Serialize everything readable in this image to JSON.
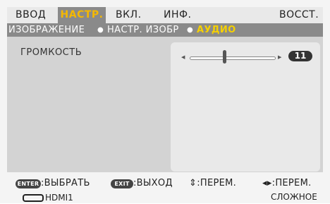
{
  "tabs": [
    {
      "label": "ВВОД",
      "active": false
    },
    {
      "label": "НАСТР.",
      "active": true
    },
    {
      "label": "ВКЛ.",
      "active": false
    },
    {
      "label": "ИНФ.",
      "active": false
    },
    {
      "label": "ВОССТ.",
      "active": false
    }
  ],
  "breadcrumb": {
    "items": [
      "ИЗОБРАЖЕНИЕ",
      "НАСТР. ИЗОБР",
      "АУДИО"
    ],
    "separator": "●"
  },
  "settings": {
    "volume": {
      "label": "ГРОМКОСТЬ",
      "value": "11",
      "level": 0.4,
      "left_arrow": "◀",
      "right_arrow": "▶"
    }
  },
  "hints": {
    "enter_key": "ENTER",
    "enter_text": ":ВЫБРАТЬ",
    "exit_key": "EXIT",
    "exit_text": ":ВЫХОД",
    "updown_text": "⇕:ПЕРЕМ.",
    "leftright_text": "◂▸:ПЕРЕМ."
  },
  "status": {
    "source": "HDMI1",
    "mode": "СЛОЖНОЕ"
  },
  "colors": {
    "accent": "#f5b800",
    "active_tab_bg": "#8a8a8a"
  }
}
